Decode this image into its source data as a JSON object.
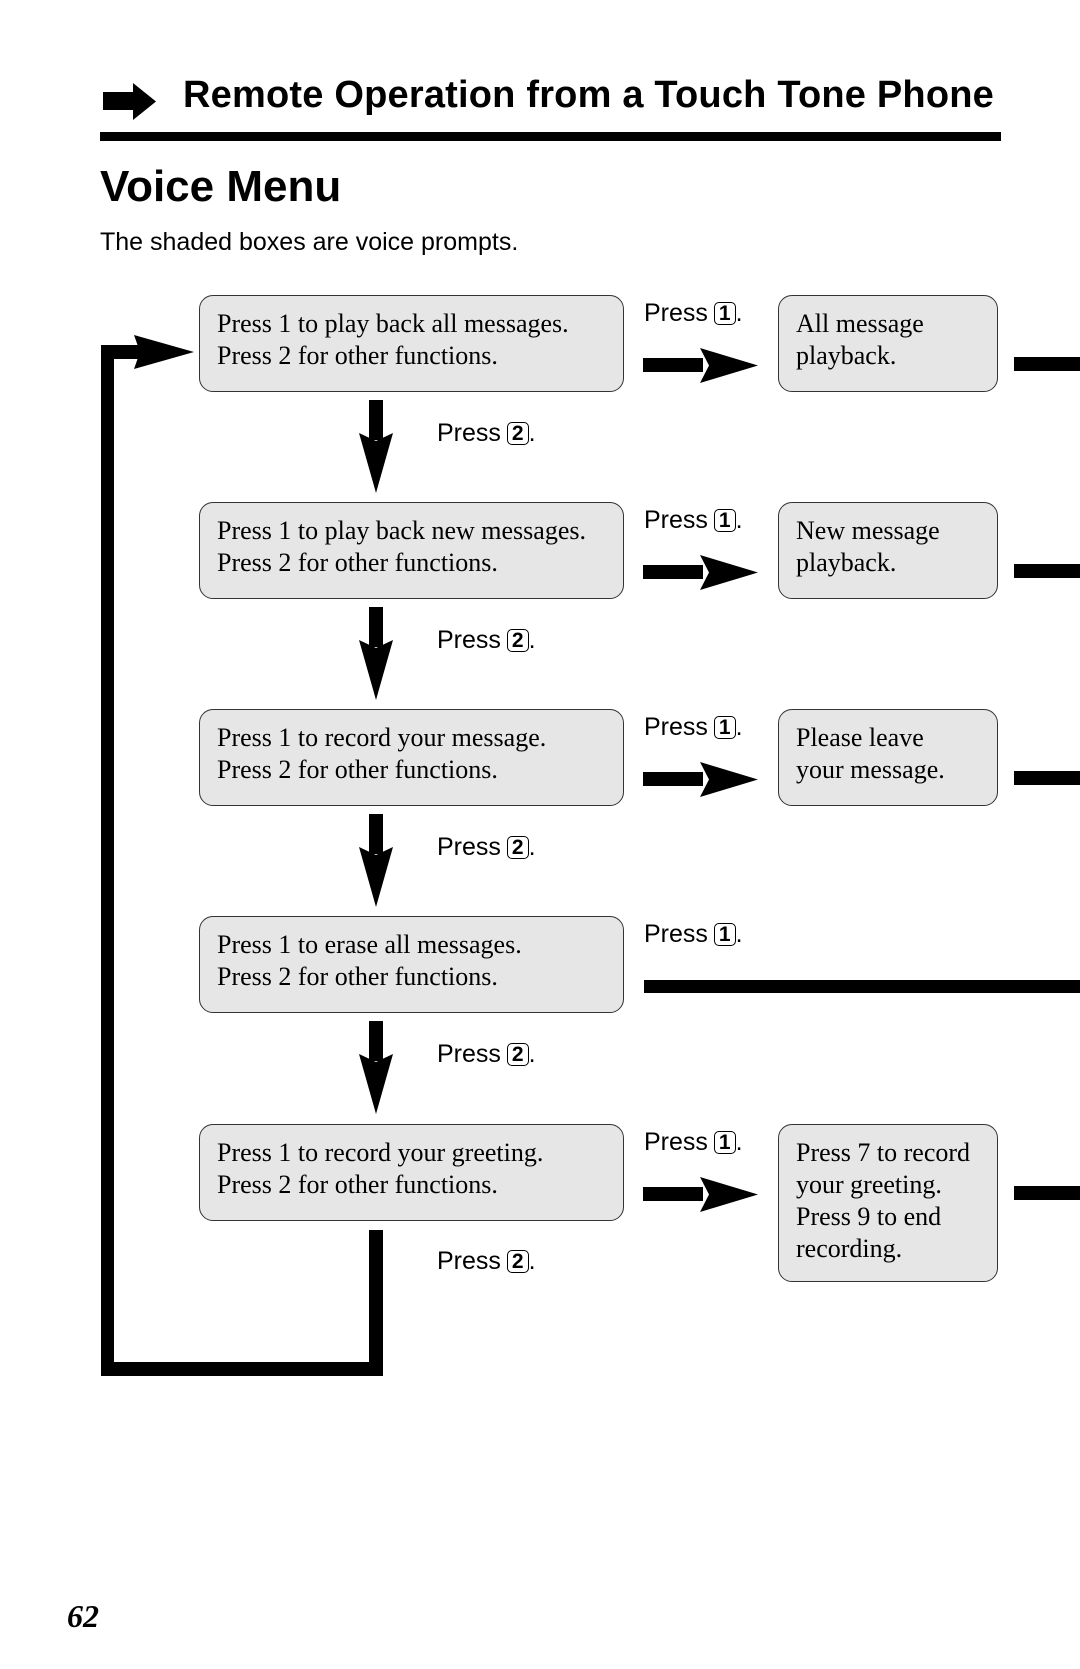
{
  "header": {
    "title": "Remote Operation from a Touch Tone Phone",
    "icon": "right-arrow-icon"
  },
  "page_title": "Voice Menu",
  "subtitle": "The shaded boxes are voice prompts.",
  "flow": {
    "press_word": "Press",
    "key_1": "1",
    "key_2": "2",
    "period": ".",
    "menu_steps": [
      {
        "line1": "Press 1 to play back all messages.",
        "line2": "Press 2 for other functions.",
        "result": [
          "All message",
          "playback."
        ]
      },
      {
        "line1": "Press 1 to play back new messages.",
        "line2": "Press 2 for other functions.",
        "result": [
          "New message",
          "playback."
        ]
      },
      {
        "line1": "Press 1 to record your message.",
        "line2": "Press 2 for other functions.",
        "result": [
          "Please leave",
          "your message."
        ]
      },
      {
        "line1": "Press 1 to erase all messages.",
        "line2": "Press 2 for other functions.",
        "result": []
      },
      {
        "line1": "Press 1 to record your greeting.",
        "line2": "Press 2 for other functions.",
        "result": [
          "Press 7 to record",
          "your greeting.",
          "Press 9 to end",
          "recording."
        ]
      }
    ]
  },
  "page_number": "62"
}
